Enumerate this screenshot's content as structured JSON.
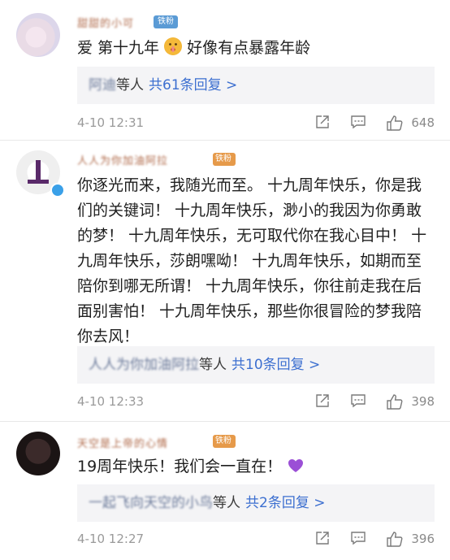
{
  "comments": [
    {
      "username": "甜甜的小可",
      "badge": "铁粉",
      "text_before": "爱 第十九年",
      "text_after": "好像有点暴露年龄",
      "reply_names": "阿迪",
      "reply_suffix": "等人",
      "reply_count": "共61条回复 >",
      "time": "4-10 12:31",
      "likes": "648"
    },
    {
      "username": "人人为你加油阿拉",
      "badge": "铁粉",
      "text": "你逐光而来，我随光而至。 十九周年快乐，你是我们的关键词！ 十九周年快乐，渺小的我因为你勇敢的梦！ 十九周年快乐，无可取代你在我心目中！ 十九周年快乐，莎朗嘿呦！ 十九周年快乐，如期而至陪你到哪无所谓！ 十九周年快乐，你往前走我在后面别害怕！ 十九周年快乐，那些你很冒险的梦我陪你去风！",
      "reply_names": "人人为你加油阿拉",
      "reply_suffix": "等人",
      "reply_count": "共10条回复 >",
      "time": "4-10 12:33",
      "likes": "398"
    },
    {
      "username": "天空是上帝的心情",
      "badge": "铁粉",
      "text": "19周年快乐！我们会一直在！",
      "reply_names": "一起飞向天空的小鸟",
      "reply_suffix": "等人",
      "reply_count": "共2条回复 >",
      "time": "4-10 12:27",
      "likes": "396"
    }
  ],
  "icons": {
    "share": "share-icon",
    "comment": "comment-icon",
    "like": "thumbs-up-icon"
  },
  "colors": {
    "link_blue": "#3c6fd0",
    "reply_bg": "#f4f4f6",
    "fan_badge": "#5b9bd5"
  }
}
